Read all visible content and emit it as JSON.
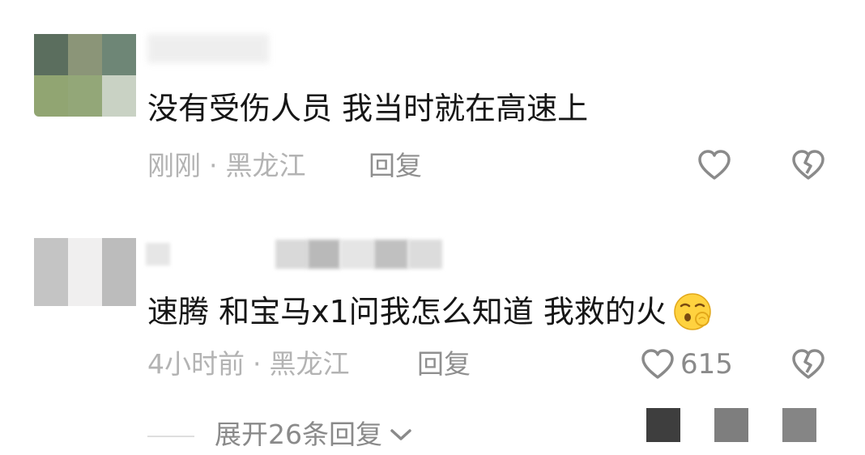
{
  "comments": [
    {
      "author": "",
      "text": "没有受伤人员 我当时就在高速上",
      "time": "刚刚",
      "location": "黑龙江",
      "separator": "·",
      "reply_label": "回复",
      "like_count": "",
      "like_icon": "heart-outline-icon",
      "dislike_icon": "broken-heart-icon"
    },
    {
      "author": "",
      "text": "速腾 和宝马x1问我怎么知道  我救的火",
      "emoji": "shushing-face-emoji",
      "time": "4小时前",
      "location": "黑龙江",
      "separator": "·",
      "reply_label": "回复",
      "like_count": "615",
      "like_icon": "heart-outline-icon",
      "dislike_icon": "broken-heart-icon",
      "expand_label": "展开26条回复",
      "expand_icon": "chevron-down-icon"
    }
  ],
  "colors": {
    "text": "#161616",
    "meta": "#b3b3b3",
    "icon": "#8a8a8a"
  }
}
